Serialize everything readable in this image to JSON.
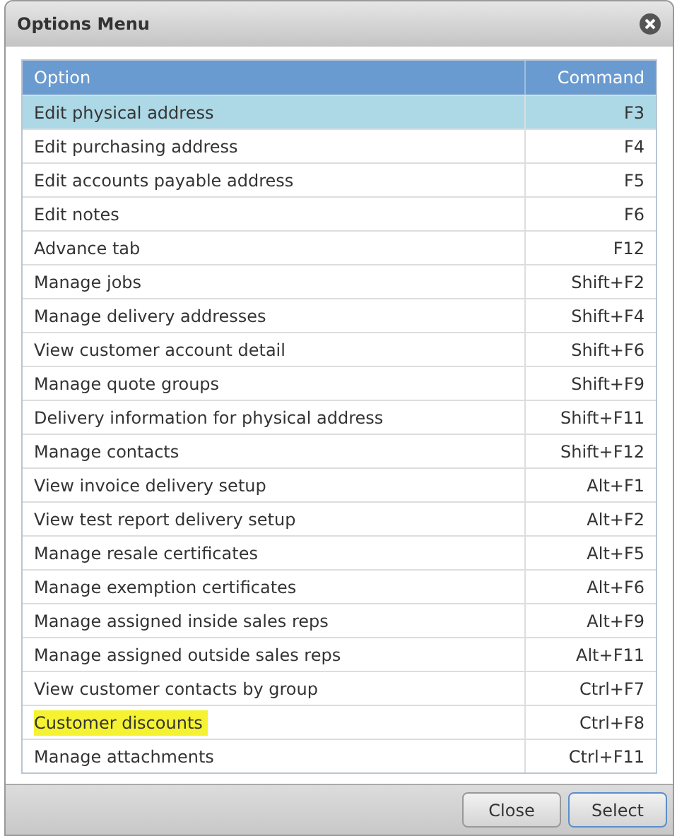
{
  "window": {
    "title": "Options Menu"
  },
  "table": {
    "columns": [
      "Option",
      "Command"
    ],
    "rows": [
      {
        "option": "Edit physical address",
        "command": "F3",
        "selected": true,
        "highlighted": false
      },
      {
        "option": "Edit purchasing address",
        "command": "F4",
        "selected": false,
        "highlighted": false
      },
      {
        "option": "Edit accounts payable address",
        "command": "F5",
        "selected": false,
        "highlighted": false
      },
      {
        "option": "Edit notes",
        "command": "F6",
        "selected": false,
        "highlighted": false
      },
      {
        "option": "Advance tab",
        "command": "F12",
        "selected": false,
        "highlighted": false
      },
      {
        "option": "Manage jobs",
        "command": "Shift+F2",
        "selected": false,
        "highlighted": false
      },
      {
        "option": "Manage delivery addresses",
        "command": "Shift+F4",
        "selected": false,
        "highlighted": false
      },
      {
        "option": "View customer account detail",
        "command": "Shift+F6",
        "selected": false,
        "highlighted": false
      },
      {
        "option": "Manage quote groups",
        "command": "Shift+F9",
        "selected": false,
        "highlighted": false
      },
      {
        "option": "Delivery information for physical address",
        "command": "Shift+F11",
        "selected": false,
        "highlighted": false
      },
      {
        "option": "Manage contacts",
        "command": "Shift+F12",
        "selected": false,
        "highlighted": false
      },
      {
        "option": "View invoice delivery setup",
        "command": "Alt+F1",
        "selected": false,
        "highlighted": false
      },
      {
        "option": "View test report delivery setup",
        "command": "Alt+F2",
        "selected": false,
        "highlighted": false
      },
      {
        "option": "Manage resale certificates",
        "command": "Alt+F5",
        "selected": false,
        "highlighted": false
      },
      {
        "option": "Manage exemption certificates",
        "command": "Alt+F6",
        "selected": false,
        "highlighted": false
      },
      {
        "option": "Manage assigned inside sales reps",
        "command": "Alt+F9",
        "selected": false,
        "highlighted": false
      },
      {
        "option": "Manage assigned outside sales reps",
        "command": "Alt+F11",
        "selected": false,
        "highlighted": false
      },
      {
        "option": "View customer contacts by group",
        "command": "Ctrl+F7",
        "selected": false,
        "highlighted": false
      },
      {
        "option": "Customer discounts",
        "command": "Ctrl+F8",
        "selected": false,
        "highlighted": true
      },
      {
        "option": "Manage attachments",
        "command": "Ctrl+F11",
        "selected": false,
        "highlighted": false
      }
    ]
  },
  "buttons": [
    {
      "label": "Close",
      "kind": "normal"
    },
    {
      "label": "Select",
      "kind": "default"
    }
  ]
}
